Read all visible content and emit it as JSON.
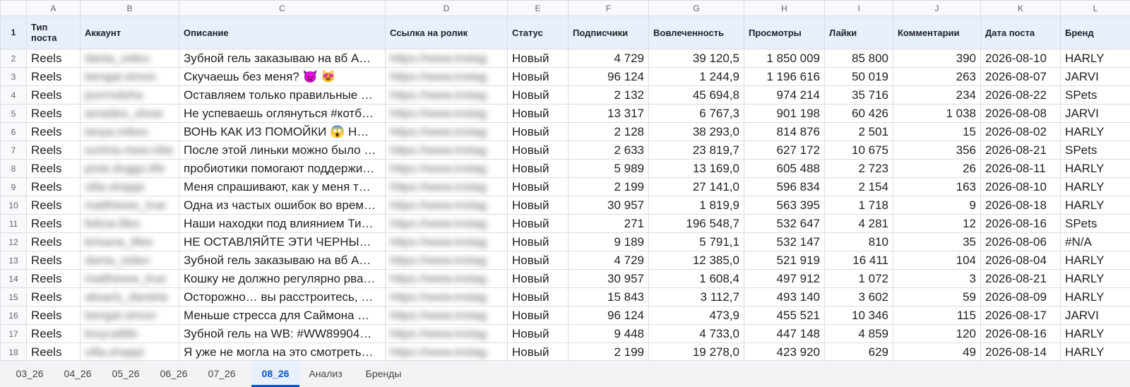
{
  "columns": [
    "A",
    "B",
    "C",
    "D",
    "E",
    "F",
    "G",
    "H",
    "I",
    "J",
    "K",
    "L"
  ],
  "header_row_number": "1",
  "headers": [
    "Тип поста",
    "Аккаунт",
    "Описание",
    "Ссылка на ролик",
    "Статус",
    "Подписчики",
    "Вовлеченность",
    "Просмотры",
    "Лайки",
    "Комментарии",
    "Дата поста",
    "Бренд"
  ],
  "rows": [
    {
      "n": "2",
      "type": "Reels",
      "account": "dania_video",
      "desc": "Зубной гель заказываю на вб А…",
      "link": "https://www.instag",
      "status": "Новый",
      "subs": "4 729",
      "eng": "39 120,5",
      "views": "1 850 009",
      "likes": "85 800",
      "comments": "390",
      "date": "2026-08-10",
      "brand": "HARLY"
    },
    {
      "n": "3",
      "type": "Reels",
      "account": "bengal.simon",
      "desc": "Скучаешь без меня? 😈 😻",
      "link": "https://www.instag",
      "status": "Новый",
      "subs": "96 124",
      "eng": "1 244,9",
      "views": "1 196 616",
      "likes": "50 019",
      "comments": "263",
      "date": "2026-08-07",
      "brand": "JARVI"
    },
    {
      "n": "4",
      "type": "Reels",
      "account": "purrrsdoha",
      "desc": "Оставляем только правильные …",
      "link": "https://www.instag",
      "status": "Новый",
      "subs": "2 132",
      "eng": "45 694,8",
      "views": "974 214",
      "likes": "35 716",
      "comments": "234",
      "date": "2026-08-22",
      "brand": "SPets"
    },
    {
      "n": "5",
      "type": "Reels",
      "account": "amadeo_show",
      "desc": "Не успеваешь оглянуться #котб…",
      "link": "https://www.instag",
      "status": "Новый",
      "subs": "13 317",
      "eng": "6 767,3",
      "views": "901 198",
      "likes": "60 426",
      "comments": "1 038",
      "date": "2026-08-08",
      "brand": "JARVI"
    },
    {
      "n": "6",
      "type": "Reels",
      "account": "lanya.mikes",
      "desc": "ВОНЬ КАК ИЗ ПОМОЙКИ 😱 Н…",
      "link": "https://www.instag",
      "status": "Новый",
      "subs": "2 128",
      "eng": "38 293,0",
      "views": "814 876",
      "likes": "2 501",
      "comments": "15",
      "date": "2026-08-02",
      "brand": "HARLY"
    },
    {
      "n": "7",
      "type": "Reels",
      "account": "sonhia.mew.vibe",
      "desc": "После этой линьки можно было …",
      "link": "https://www.instag",
      "status": "Новый",
      "subs": "2 633",
      "eng": "23 819,7",
      "views": "627 172",
      "likes": "10 675",
      "comments": "356",
      "date": "2026-08-21",
      "brand": "SPets"
    },
    {
      "n": "8",
      "type": "Reels",
      "account": "pixie.doggo.life",
      "desc": "пробиотики помогают поддержи…",
      "link": "https://www.instag",
      "status": "Новый",
      "subs": "5 989",
      "eng": "13 169,0",
      "views": "605 488",
      "likes": "2 723",
      "comments": "26",
      "date": "2026-08-11",
      "brand": "HARLY"
    },
    {
      "n": "9",
      "type": "Reels",
      "account": "villa.shappi",
      "desc": "Меня спрашивают, как у меня т…",
      "link": "https://www.instag",
      "status": "Новый",
      "subs": "2 199",
      "eng": "27 141,0",
      "views": "596 834",
      "likes": "2 154",
      "comments": "163",
      "date": "2026-08-10",
      "brand": "HARLY"
    },
    {
      "n": "10",
      "type": "Reels",
      "account": "mattheww_true",
      "desc": "Одна из частых ошибок во врем…",
      "link": "https://www.instag",
      "status": "Новый",
      "subs": "30 957",
      "eng": "1 819,9",
      "views": "563 395",
      "likes": "1 718",
      "comments": "9",
      "date": "2026-08-18",
      "brand": "HARLY"
    },
    {
      "n": "11",
      "type": "Reels",
      "account": "felicia.lifes",
      "desc": "Наши находки под влиянием Ти…",
      "link": "https://www.instag",
      "status": "Новый",
      "subs": "271",
      "eng": "196 548,7",
      "views": "532 647",
      "likes": "4 281",
      "comments": "12",
      "date": "2026-08-16",
      "brand": "SPets"
    },
    {
      "n": "12",
      "type": "Reels",
      "account": "brisana_lifee",
      "desc": "НЕ ОСТАВЛЯЙТЕ ЭТИ ЧЕРНЫ…",
      "link": "https://www.instag",
      "status": "Новый",
      "subs": "9 189",
      "eng": "5 791,1",
      "views": "532 147",
      "likes": "810",
      "comments": "35",
      "date": "2026-08-06",
      "brand": "#N/A"
    },
    {
      "n": "13",
      "type": "Reels",
      "account": "dania_video",
      "desc": "Зубной гель заказываю на вб А…",
      "link": "https://www.instag",
      "status": "Новый",
      "subs": "4 729",
      "eng": "12 385,0",
      "views": "521 919",
      "likes": "16 411",
      "comments": "104",
      "date": "2026-08-04",
      "brand": "HARLY"
    },
    {
      "n": "14",
      "type": "Reels",
      "account": "mattheww_true",
      "desc": "Кошку не должно регулярно рва…",
      "link": "https://www.instag",
      "status": "Новый",
      "subs": "30 957",
      "eng": "1 608,4",
      "views": "497 912",
      "likes": "1 072",
      "comments": "3",
      "date": "2026-08-21",
      "brand": "HARLY"
    },
    {
      "n": "15",
      "type": "Reels",
      "account": "alisaris_daniela",
      "desc": "Осторожно… вы расстроитесь, …",
      "link": "https://www.instag",
      "status": "Новый",
      "subs": "15 843",
      "eng": "3 112,7",
      "views": "493 140",
      "likes": "3 602",
      "comments": "59",
      "date": "2026-08-09",
      "brand": "HARLY"
    },
    {
      "n": "16",
      "type": "Reels",
      "account": "bengal.simon",
      "desc": "Меньше стресса для Саймона …",
      "link": "https://www.instag",
      "status": "Новый",
      "subs": "96 124",
      "eng": "473,9",
      "views": "455 521",
      "likes": "10 346",
      "comments": "115",
      "date": "2026-08-17",
      "brand": "JARVI"
    },
    {
      "n": "17",
      "type": "Reels",
      "account": "lexycatlife",
      "desc": "Зубной гель на WB: #WW89904…",
      "link": "https://www.instag",
      "status": "Новый",
      "subs": "9 448",
      "eng": "4 733,0",
      "views": "447 148",
      "likes": "4 859",
      "comments": "120",
      "date": "2026-08-16",
      "brand": "HARLY"
    },
    {
      "n": "18",
      "type": "Reels",
      "account": "villa.shappi",
      "desc": "Я уже не могла на это смотреть…",
      "link": "https://www.instag",
      "status": "Новый",
      "subs": "2 199",
      "eng": "19 278,0",
      "views": "423 920",
      "likes": "629",
      "comments": "49",
      "date": "2026-08-14",
      "brand": "HARLY"
    }
  ],
  "sheet_tabs": [
    "03_26",
    "04_26",
    "05_26",
    "06_26",
    "07_26",
    "08_26",
    "Анализ",
    "Бренды"
  ],
  "active_tab": "08_26",
  "colors": {
    "header_fill": "#e8f0fe",
    "active_tab": "#0b57d0",
    "grid": "#dadce0"
  }
}
